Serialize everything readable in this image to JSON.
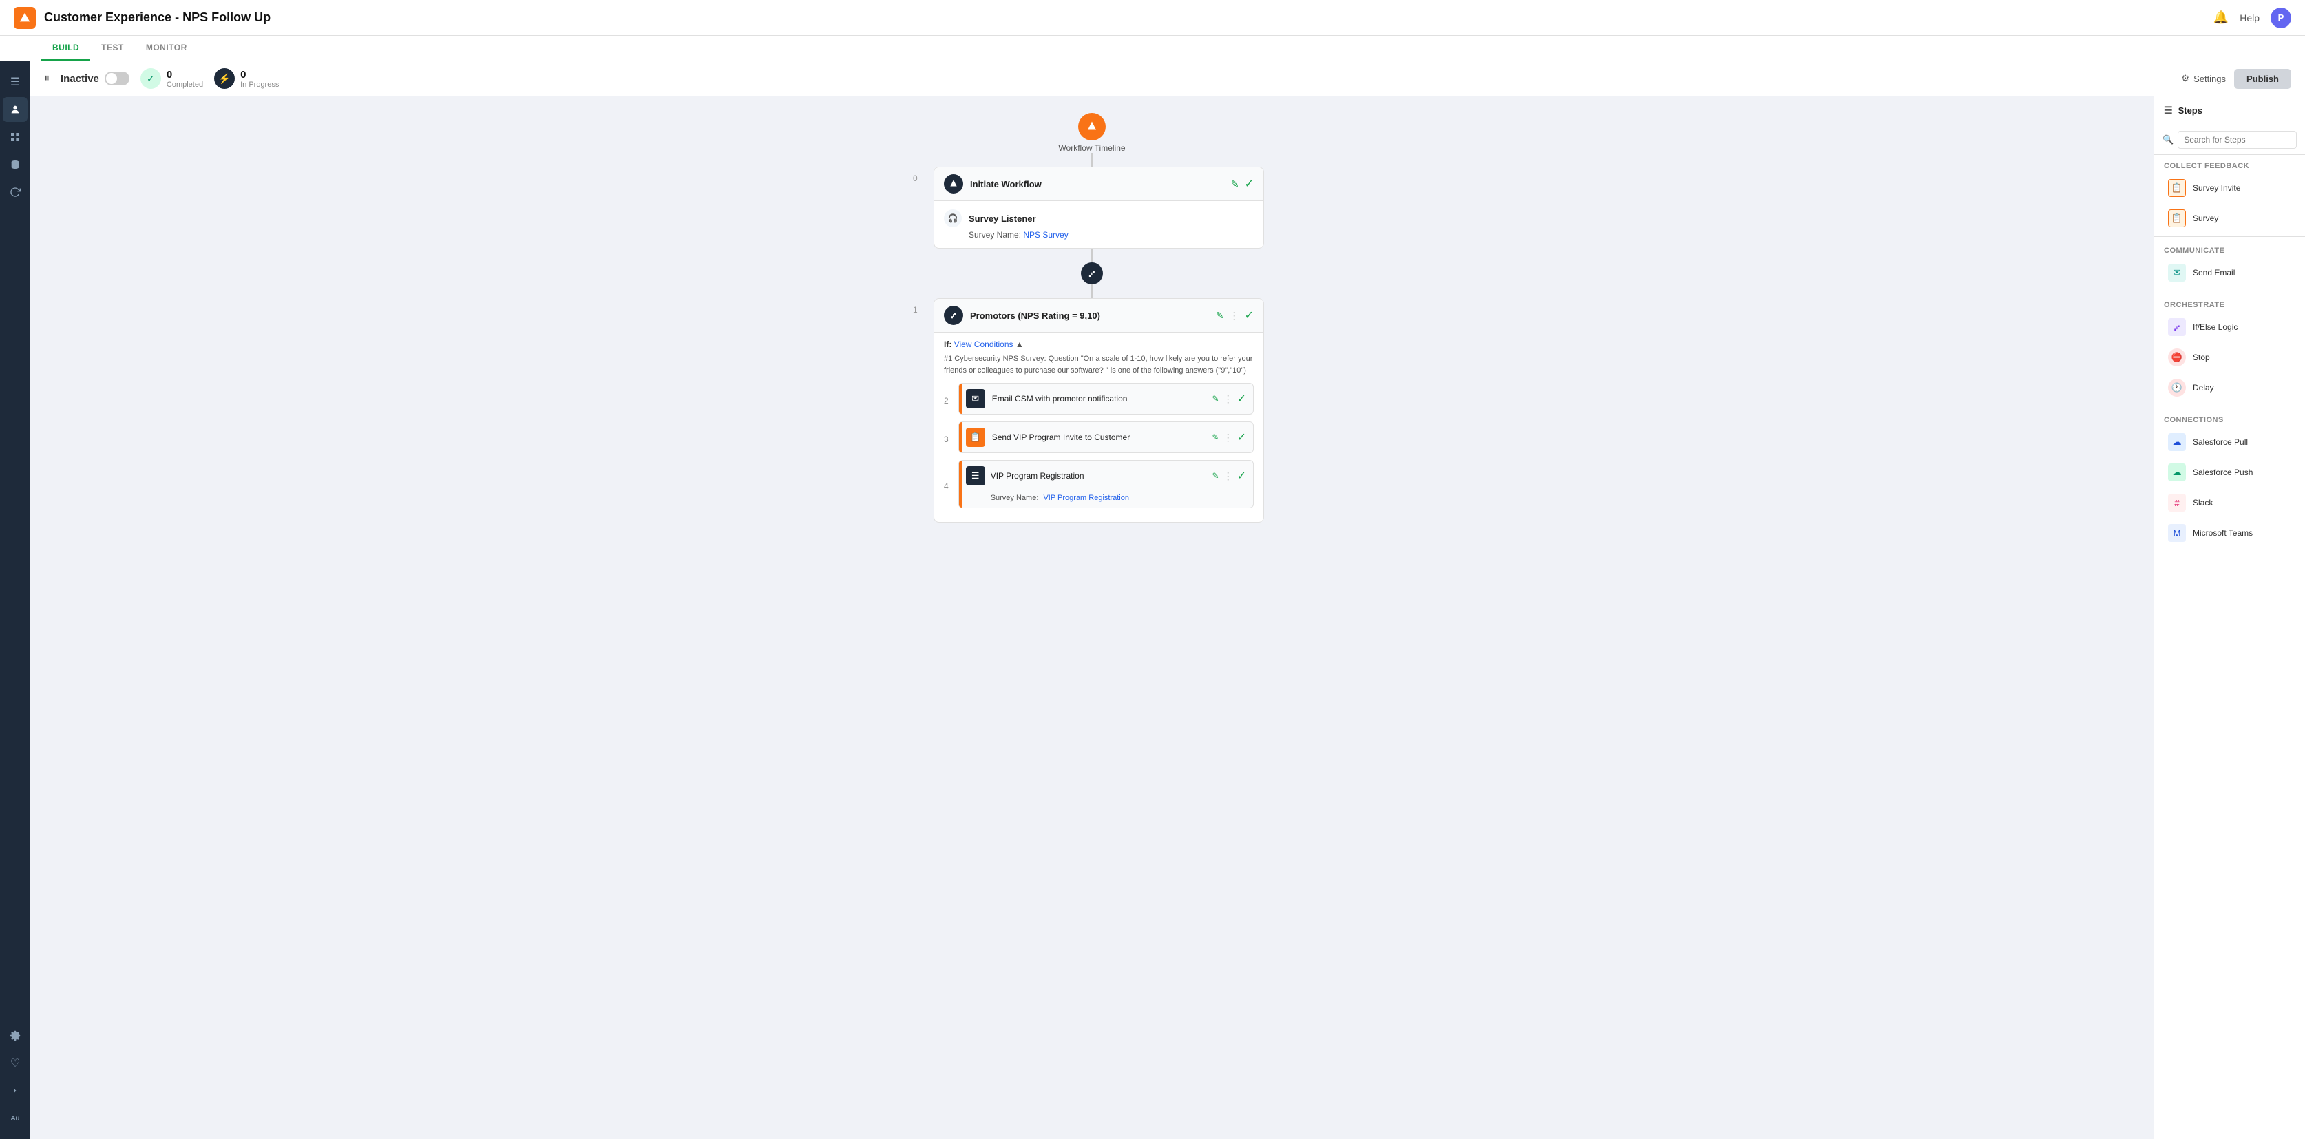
{
  "header": {
    "title": "Customer Experience - NPS Follow Up",
    "help_label": "Help",
    "avatar_letter": "P"
  },
  "tabs": [
    {
      "id": "build",
      "label": "BUILD",
      "active": true
    },
    {
      "id": "test",
      "label": "TEST",
      "active": false
    },
    {
      "id": "monitor",
      "label": "MONITOR",
      "active": false
    }
  ],
  "toolbar": {
    "status_label": "Inactive",
    "completed_count": "0",
    "completed_label": "Completed",
    "inprogress_count": "0",
    "inprogress_label": "In Progress",
    "settings_label": "Settings",
    "publish_label": "Publish"
  },
  "workflow": {
    "start_label": "Workflow Timeline",
    "node0_label": "Initiate Workflow",
    "node0_sublabel": "Survey Listener",
    "node0_survey_prefix": "Survey Name:",
    "node0_survey_name": "NPS Survey",
    "step1_label": "Promotors (NPS Rating = 9,10)",
    "step1_if": "If:",
    "step1_conditions": "View Conditions",
    "step1_condition_text": "#1 Cybersecurity NPS Survey: Question \"On a scale of 1-10, how likely are you to refer your friends or colleagues to purchase our software? \" is one of the following answers (\"9\",\"10\")",
    "substeps": [
      {
        "num": "2",
        "label": "Email CSM with promotor notification",
        "icon": "email"
      },
      {
        "num": "3",
        "label": "Send VIP Program Invite to Customer",
        "icon": "survey-invite"
      },
      {
        "num": "4",
        "label": "VIP Program Registration",
        "icon": "list",
        "survey_prefix": "Survey Name:",
        "survey_name": "VIP Program Registration"
      }
    ]
  },
  "right_panel": {
    "title": "Steps",
    "search_placeholder": "Search for Steps",
    "sections": [
      {
        "label": "Collect Feedback",
        "items": [
          {
            "id": "survey-invite",
            "label": "Survey Invite",
            "icon": "survey-invite",
            "icon_class": "icon-orange-outline"
          },
          {
            "id": "survey",
            "label": "Survey",
            "icon": "survey",
            "icon_class": "icon-orange-outline"
          }
        ]
      },
      {
        "label": "Communicate",
        "items": [
          {
            "id": "send-email",
            "label": "Send Email",
            "icon": "email",
            "icon_class": "icon-teal"
          }
        ]
      },
      {
        "label": "Orchestrate",
        "items": [
          {
            "id": "if-else-logic",
            "label": "If/Else Logic",
            "icon": "branch",
            "icon_class": "icon-purple"
          },
          {
            "id": "stop",
            "label": "Stop",
            "icon": "stop",
            "icon_class": "icon-red"
          },
          {
            "id": "delay",
            "label": "Delay",
            "icon": "clock",
            "icon_class": "icon-red"
          }
        ]
      },
      {
        "label": "Connections",
        "items": [
          {
            "id": "salesforce-pull",
            "label": "Salesforce Pull",
            "icon": "sf",
            "icon_class": "icon-blue-sf"
          },
          {
            "id": "salesforce-push",
            "label": "Salesforce Push",
            "icon": "sf",
            "icon_class": "icon-green-sf"
          },
          {
            "id": "slack",
            "label": "Slack",
            "icon": "slack",
            "icon_class": "icon-slack"
          },
          {
            "id": "microsoft-teams",
            "label": "Microsoft Teams",
            "icon": "ms",
            "icon_class": "icon-ms"
          }
        ]
      }
    ]
  },
  "sidebar_icons": [
    {
      "id": "menu",
      "symbol": "☰"
    },
    {
      "id": "profile",
      "symbol": "👤"
    },
    {
      "id": "grid",
      "symbol": "⊞"
    },
    {
      "id": "database",
      "symbol": "🗄"
    },
    {
      "id": "refresh",
      "symbol": "↻"
    },
    {
      "id": "settings",
      "symbol": "⚙"
    },
    {
      "id": "heart",
      "symbol": "♡"
    },
    {
      "id": "badge",
      "symbol": "Au"
    }
  ]
}
